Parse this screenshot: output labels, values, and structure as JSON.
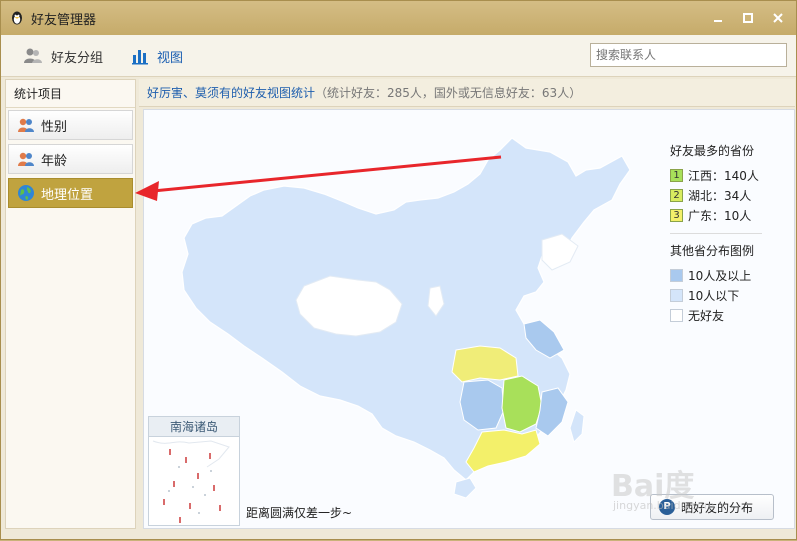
{
  "window": {
    "title": "好友管理器"
  },
  "toolbar": {
    "friends_group_label": "好友分组",
    "view_label": "视图",
    "search_placeholder": "搜索联系人"
  },
  "sidebar": {
    "header": "统计项目",
    "items": [
      {
        "label": "性别",
        "icon": "people-icon"
      },
      {
        "label": "年龄",
        "icon": "people-icon"
      },
      {
        "label": "地理位置",
        "icon": "globe-icon",
        "active": true
      }
    ]
  },
  "content": {
    "title": "好厉害、莫须有的好友视图统计",
    "subtitle": "（统计好友：285人，国外或无信息好友：63人）"
  },
  "legend": {
    "top_title": "好友最多的省份",
    "top_provinces": [
      {
        "rank": "1",
        "text": "江西：140人",
        "color": "#a8e05a"
      },
      {
        "rank": "2",
        "text": "湖北：34人",
        "color": "#d8ec60"
      },
      {
        "rank": "3",
        "text": "广东：10人",
        "color": "#f3f06a"
      }
    ],
    "other_title": "其他省分布图例",
    "other": [
      {
        "text": "10人及以上",
        "color": "#a9c9ee"
      },
      {
        "text": "10人以下",
        "color": "#d4e5fa"
      },
      {
        "text": "无好友",
        "color": "#ffffff"
      }
    ]
  },
  "inset": {
    "title": "南海诸岛"
  },
  "bottom_note": "距离圆满仅差一步~",
  "share_button": "晒好友的分布",
  "watermark": {
    "main": "Bai度",
    "sub": "jingyan.baidu.com"
  },
  "colors": {
    "accent_active": "#c0a33f",
    "map_base": "#d4e5fa",
    "arrow": "#e8262b"
  }
}
